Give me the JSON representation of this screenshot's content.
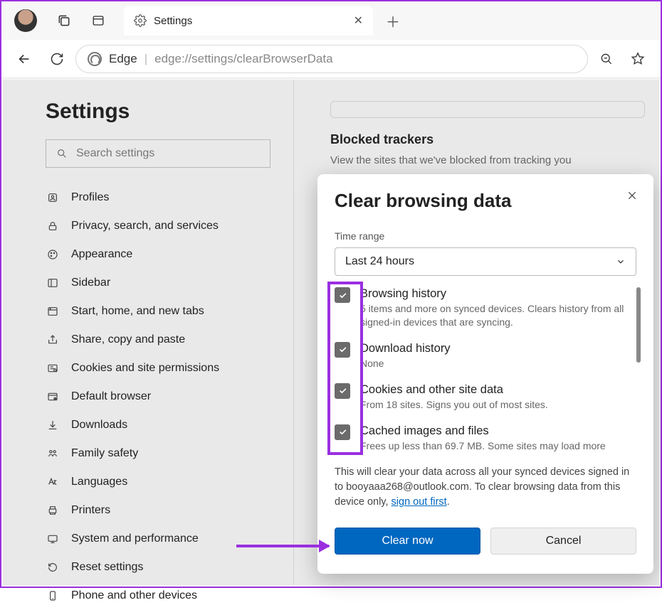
{
  "titlebar": {
    "tab_title": "Settings",
    "close_glyph": "✕",
    "newtab_glyph": "＋"
  },
  "urlbar": {
    "browser_label": "Edge",
    "separator": "|",
    "url_host": "edge://",
    "url_path": "settings/clearBrowserData"
  },
  "sidebar": {
    "heading": "Settings",
    "search_placeholder": "Search settings",
    "items": [
      {
        "icon": "profile",
        "label": "Profiles"
      },
      {
        "icon": "lock",
        "label": "Privacy, search, and services"
      },
      {
        "icon": "palette",
        "label": "Appearance"
      },
      {
        "icon": "sidebar",
        "label": "Sidebar"
      },
      {
        "icon": "home",
        "label": "Start, home, and new tabs"
      },
      {
        "icon": "share",
        "label": "Share, copy and paste"
      },
      {
        "icon": "cookie",
        "label": "Cookies and site permissions"
      },
      {
        "icon": "browser",
        "label": "Default browser"
      },
      {
        "icon": "download",
        "label": "Downloads"
      },
      {
        "icon": "family",
        "label": "Family safety"
      },
      {
        "icon": "lang",
        "label": "Languages"
      },
      {
        "icon": "printer",
        "label": "Printers"
      },
      {
        "icon": "perf",
        "label": "System and performance"
      },
      {
        "icon": "reset",
        "label": "Reset settings"
      },
      {
        "icon": "phone",
        "label": "Phone and other devices"
      }
    ]
  },
  "main": {
    "blocked_heading": "Blocked trackers",
    "blocked_sub": "View the sites that we've blocked from tracking you"
  },
  "modal": {
    "title": "Clear browsing data",
    "time_label": "Time range",
    "time_value": "Last 24 hours",
    "options": [
      {
        "title": "Browsing history",
        "desc": "5 items and more on synced devices. Clears history from all signed-in devices that are syncing."
      },
      {
        "title": "Download history",
        "desc": "None"
      },
      {
        "title": "Cookies and other site data",
        "desc": "From 18 sites. Signs you out of most sites."
      },
      {
        "title": "Cached images and files",
        "desc": "Frees up less than 69.7 MB. Some sites may load more"
      }
    ],
    "footnote_pre": "This will clear your data across all your synced devices signed in to booyaaa268@outlook.com. To clear browsing data from this device only, ",
    "footnote_link": "sign out first",
    "footnote_post": ".",
    "clear_btn": "Clear now",
    "cancel_btn": "Cancel"
  }
}
